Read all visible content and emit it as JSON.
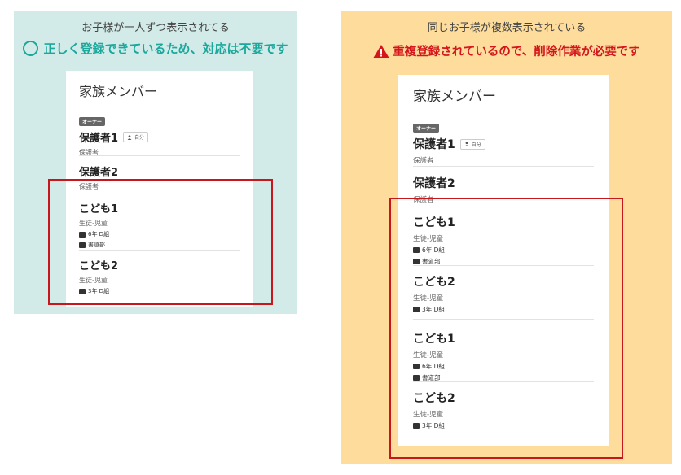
{
  "left": {
    "subtitle": "お子様が一人ずつ表示されてる",
    "headline": "正しく登録できているため、対応は不要です",
    "card_title": "家族メンバー",
    "owner_badge": "オーナー",
    "guardian1": {
      "name": "保護者1",
      "self_tag": "自分",
      "role": "保護者"
    },
    "guardian2": {
      "name": "保護者2",
      "role": "保護者"
    },
    "children": [
      {
        "name": "こども1",
        "role": "生徒-児童",
        "grade": "6年 D組",
        "club": "書道部"
      },
      {
        "name": "こども2",
        "role": "生徒-児童",
        "grade": "3年 D組"
      }
    ]
  },
  "right": {
    "subtitle": "同じお子様が複数表示されている",
    "headline": "重複登録されているので、削除作業が必要です",
    "card_title": "家族メンバー",
    "owner_badge": "オーナー",
    "guardian1": {
      "name": "保護者1",
      "self_tag": "自分",
      "role": "保護者"
    },
    "guardian2": {
      "name": "保護者2",
      "role": "保護者"
    },
    "children": [
      {
        "name": "こども1",
        "role": "生徒-児童",
        "grade": "6年 D組",
        "club": "書道部"
      },
      {
        "name": "こども2",
        "role": "生徒-児童",
        "grade": "3年 D組"
      },
      {
        "name": "こども1",
        "role": "生徒-児童",
        "grade": "6年 D組",
        "club": "書道部"
      },
      {
        "name": "こども2",
        "role": "生徒-児童",
        "grade": "3年 D組"
      }
    ]
  },
  "colors": {
    "ok": "#1aa89d",
    "warn": "#d4151b",
    "box": "#c8161d",
    "left_bg": "#d2ebe8",
    "right_bg": "#fddc9c"
  }
}
